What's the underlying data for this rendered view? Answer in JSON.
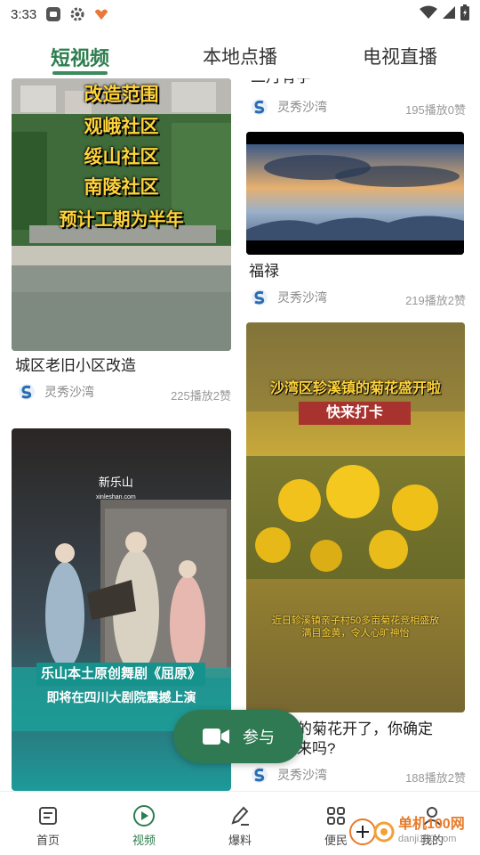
{
  "status_bar": {
    "time": "3:33"
  },
  "tabs": [
    {
      "label": "短视频",
      "active": true
    },
    {
      "label": "本地点播",
      "active": false
    },
    {
      "label": "电视直播",
      "active": false
    }
  ],
  "cards": {
    "left1": {
      "overlay_lines": [
        "改造范围",
        "观峨社区",
        "绥山社区",
        "南陵社区",
        "预计工期为半年"
      ],
      "title": "城区老旧小区改造",
      "author": "灵秀沙湾",
      "stats": "225播放2赞"
    },
    "left2": {
      "brand": "新乐山",
      "brand_sub": "xinleshan.com",
      "caption1": "乐山本土原创舞剧《屈原》",
      "caption2": "即将在四川大剧院震撼上演"
    },
    "right1": {
      "title_partial": "二月有字",
      "author": "灵秀沙湾",
      "stats": "195播放0赞"
    },
    "right2": {
      "title": "福禄",
      "author": "灵秀沙湾",
      "stats": "219播放2赞"
    },
    "right3": {
      "overlay_top": "沙湾区轸溪镇的菊花盛开啦",
      "overlay_badge": "快来打卡",
      "subtitle1": "近日轸溪镇亲子村50多亩菊花竞相盛放",
      "subtitle2": "满目金黄，令人心旷神怡",
      "title_line1": "的菊花开了，你确定",
      "title_line2": "来吗?",
      "author": "灵秀沙湾",
      "stats": "188播放2赞"
    }
  },
  "participate": {
    "label": "参与"
  },
  "bottom_nav": [
    {
      "label": "首页",
      "icon": "document-icon",
      "active": false
    },
    {
      "label": "视频",
      "icon": "play-circle-icon",
      "active": true
    },
    {
      "label": "爆料",
      "icon": "pen-icon",
      "active": false
    },
    {
      "label": "便民",
      "icon": "grid-icon",
      "active": false
    },
    {
      "label": "我的",
      "icon": "person-icon",
      "active": false
    }
  ],
  "watermark": {
    "text": "单机100网",
    "url": "danji100.com"
  },
  "colors": {
    "accent": "#2e7d4f",
    "button": "#2f7a52",
    "overlay_text": "#ffd43a"
  }
}
